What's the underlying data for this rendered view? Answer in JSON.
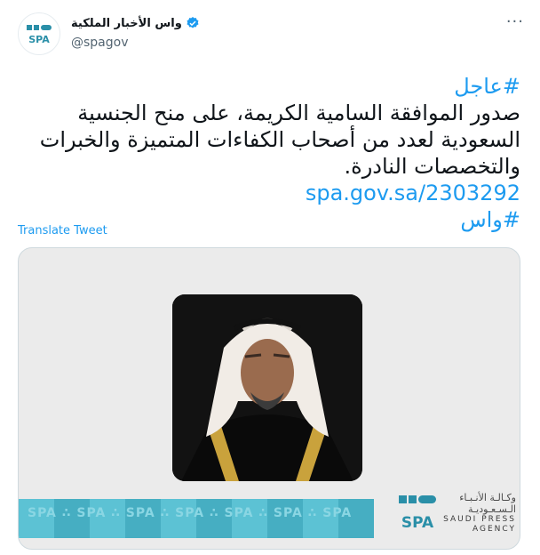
{
  "tweet": {
    "author_name": "واس الأخبار الملكية",
    "handle": "@spagov",
    "more_label": "···",
    "body_lines": [
      "#عاجل",
      "صدور الموافقة السامية الكريمة، على منح الجنسية",
      "السعودية لعدد من أصحاب الكفاءات المتميزة والخبرات",
      "والتخصصات النادرة."
    ],
    "link": "spa.gov.sa/2303292",
    "hashtag": "#واس",
    "translate_label": "Translate Tweet"
  },
  "media": {
    "logo_text": "SPA",
    "agency_arabic_line1": "وكـالـة الأنـبـاء",
    "agency_arabic_line2": "الـسـعـوديـة",
    "agency_english_line1": "SAUDI PRESS",
    "agency_english_line2": "AGENCY"
  },
  "colors": {
    "accent": "#1d9bf0",
    "verified": "#1d9bf0",
    "logo": "#2a8fa8",
    "strip": "#5cc2d4"
  },
  "icons": [
    "verified-badge-icon",
    "more-options-icon",
    "spa-logo-icon"
  ]
}
